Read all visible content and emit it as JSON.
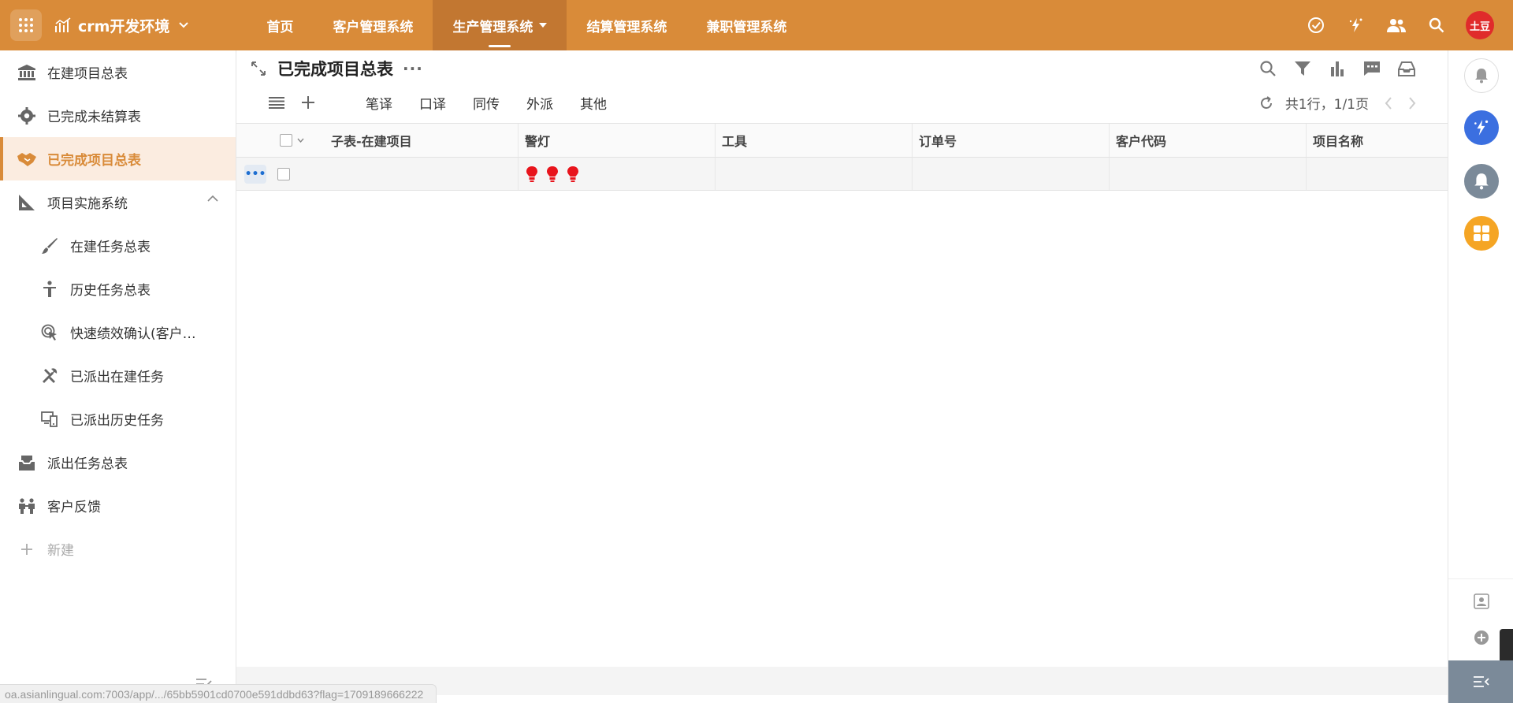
{
  "topbar": {
    "app_name": "crm开发环境",
    "nav": [
      {
        "label": "首页"
      },
      {
        "label": "客户管理系统"
      },
      {
        "label": "生产管理系统"
      },
      {
        "label": "结算管理系统"
      },
      {
        "label": "兼职管理系统"
      }
    ],
    "active_nav": "生产管理系统",
    "avatar_text": "土豆",
    "brand_color": "#d98b39"
  },
  "sidebar": {
    "items": [
      {
        "label": "在建项目总表",
        "icon": "bank-icon"
      },
      {
        "label": "已完成未结算表",
        "icon": "gear-person-icon"
      },
      {
        "label": "已完成项目总表",
        "icon": "handshake-icon",
        "active": true
      },
      {
        "label": "项目实施系统",
        "icon": "ruler-triangle-icon",
        "expanded": true
      },
      {
        "label": "在建任务总表",
        "icon": "brush-icon"
      },
      {
        "label": "历史任务总表",
        "icon": "person-icon"
      },
      {
        "label": "快速绩效确认(客户…",
        "icon": "cursor-click-icon"
      },
      {
        "label": "已派出在建任务",
        "icon": "tools-icon"
      },
      {
        "label": "已派出历史任务",
        "icon": "devices-icon"
      },
      {
        "label": "派出任务总表",
        "icon": "inbox-icon"
      },
      {
        "label": "客户反馈",
        "icon": "people-icon"
      },
      {
        "label": "新建",
        "icon": "plus-icon"
      }
    ]
  },
  "main": {
    "page_title": "已完成项目总表",
    "views": [
      "笔译",
      "口译",
      "同传",
      "外派",
      "其他"
    ],
    "pager_text": "共1行，1/1页",
    "columns": [
      "子表-在建项目",
      "警灯",
      "工具",
      "订单号",
      "客户代码",
      "项目名称"
    ],
    "rows": [
      {
        "sub_table": "",
        "lights": 3,
        "tool": "",
        "order_no": "",
        "customer_code": "",
        "project_name": ""
      }
    ],
    "light_color": "#e8141c"
  },
  "status_url": "oa.asianlingual.com:7003/app/.../65bb5901cd0700e591ddbd63?flag=1709189666222"
}
